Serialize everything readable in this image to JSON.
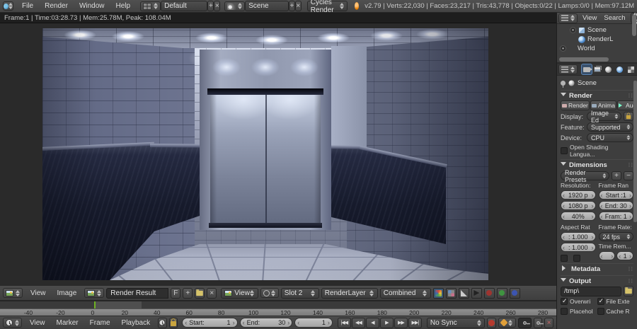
{
  "topbar": {
    "menus": [
      "File",
      "Render",
      "Window",
      "Help"
    ],
    "layout": "Default",
    "scene": "Scene",
    "engine": "Cycles Render",
    "stats": "v2.79 | Verts:22,030 | Faces:23,217 | Tris:43,778 | Objects:0/22 | Lamps:0/0 | Mem:97.12M"
  },
  "render_info": "Frame:1 | Time:03:28.73 | Mem:25.78M, Peak: 108.04M",
  "outliner": {
    "menus": [
      "View",
      "Search"
    ],
    "display_mode": "All Sc",
    "items": [
      {
        "label": "Scene"
      },
      {
        "label": "RenderL"
      },
      {
        "label": "World"
      }
    ]
  },
  "properties": {
    "context": "Scene",
    "render": {
      "title": "Render",
      "render_button": "Render",
      "animation_button": "Anima",
      "audio_button": "Audio",
      "display_label": "Display:",
      "display_value": "Image Ed",
      "feature_label": "Feature:",
      "feature_value": "Supported",
      "device_label": "Device:",
      "device_value": "CPU",
      "osl_label": "Open Shading Langua..."
    },
    "dimensions": {
      "title": "Dimensions",
      "presets": "Render Presets",
      "resolution_label": "Resolution:",
      "frame_range_label": "Frame Ran",
      "res_x": "1920 p",
      "res_y": "1080 p",
      "res_pct": "40%",
      "frame_start": "Start :1",
      "frame_end": "End: 30",
      "frame_step": "Fram: 1",
      "aspect_label": "Aspect Rat",
      "frame_rate_label": "Frame Rate:",
      "aspect_x": ": 1.000",
      "aspect_y": ": 1.000",
      "fps": "24 fps",
      "time_remap_label": "Time Rem...",
      "time_remap_value": "1"
    },
    "metadata_title": "Metadata",
    "output": {
      "title": "Output",
      "path": "/tmp\\",
      "checkboxes": [
        {
          "label": "Overwri",
          "checked": true
        },
        {
          "label": "File Exte",
          "checked": true
        },
        {
          "label": "Placehol",
          "checked": false
        },
        {
          "label": "Cache R",
          "checked": false
        }
      ]
    }
  },
  "image_editor": {
    "menus": [
      "View",
      "Image"
    ],
    "image_name": "Render Result",
    "fake_user": "F",
    "view_menu": "View",
    "slot": "Slot 2",
    "layer": "RenderLayer",
    "pass": "Combined"
  },
  "timeline": {
    "ticks": [
      "-40",
      "-20",
      "0",
      "20",
      "40",
      "60",
      "80",
      "100",
      "120",
      "140",
      "160",
      "180",
      "200",
      "220",
      "240",
      "260",
      "280"
    ],
    "menus": [
      "View",
      "Marker",
      "Frame",
      "Playback"
    ],
    "start_label": "Start:",
    "start_value": "1",
    "end_label": "End:",
    "end_value": "30",
    "current_frame": "1",
    "sync": "No Sync"
  },
  "colors": {
    "cursor_green": "#6fb322",
    "record_red": "#b63a2e",
    "keying_orange": "#e0a03a"
  }
}
